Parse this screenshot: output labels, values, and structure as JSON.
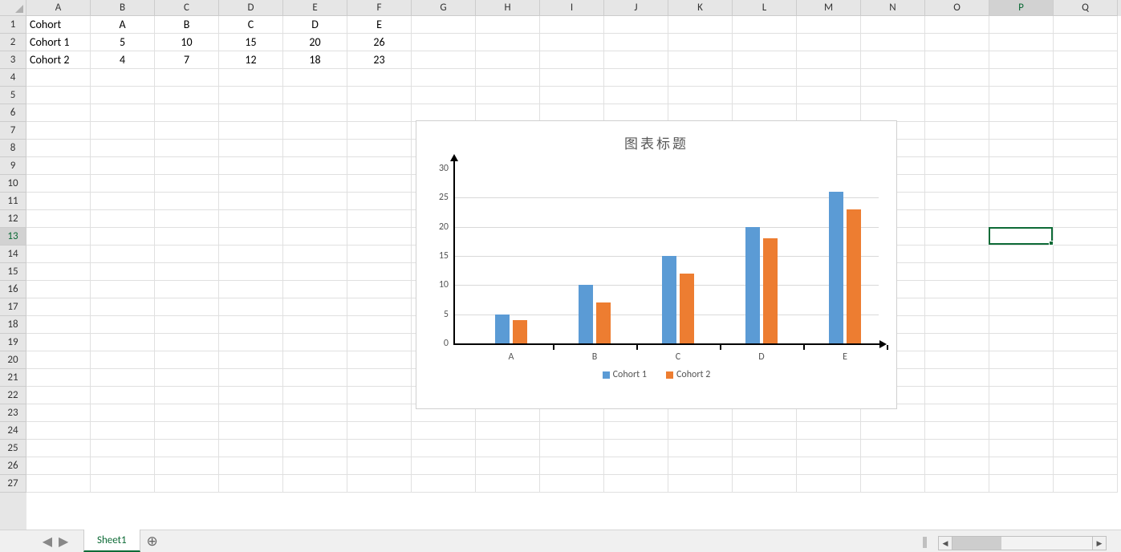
{
  "columns": [
    "A",
    "B",
    "C",
    "D",
    "E",
    "F",
    "G",
    "H",
    "I",
    "J",
    "K",
    "L",
    "M",
    "N",
    "O",
    "P",
    "Q"
  ],
  "row_count": 27,
  "data_rows": [
    [
      "Cohort",
      "A",
      "B",
      "C",
      "D",
      "E"
    ],
    [
      "Cohort 1",
      "5",
      "10",
      "15",
      "20",
      "26"
    ],
    [
      "Cohort 2",
      "4",
      "7",
      "12",
      "18",
      "23"
    ]
  ],
  "active_cell": {
    "col": 15,
    "row": 12,
    "col_letter": "P",
    "row_number": "13"
  },
  "sheet_tab": "Sheet1",
  "chart_data": {
    "type": "bar",
    "title": "图表标题",
    "categories": [
      "A",
      "B",
      "C",
      "D",
      "E"
    ],
    "series": [
      {
        "name": "Cohort 1",
        "values": [
          5,
          10,
          15,
          20,
          26
        ],
        "color": "#5b9bd5"
      },
      {
        "name": "Cohort 2",
        "values": [
          4,
          7,
          12,
          18,
          23
        ],
        "color": "#ed7d31"
      }
    ],
    "ylim": [
      0,
      30
    ],
    "ystep": 5
  }
}
